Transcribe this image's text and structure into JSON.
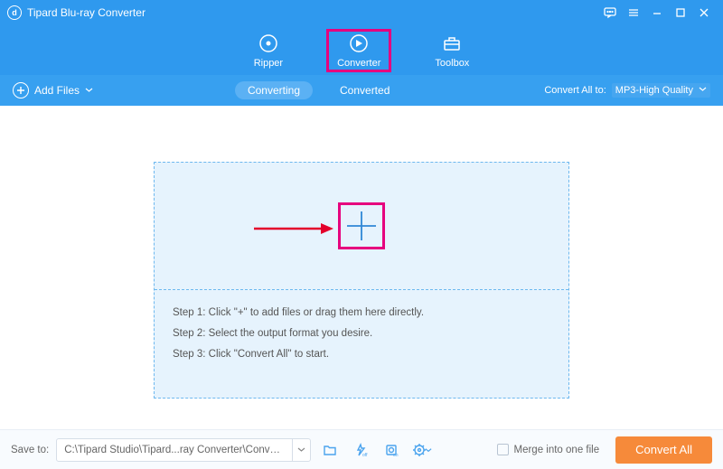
{
  "titlebar": {
    "title": "Tipard Blu-ray Converter"
  },
  "header_tabs": {
    "ripper": "Ripper",
    "converter": "Converter",
    "toolbox": "Toolbox"
  },
  "subbar": {
    "add_files": "Add Files",
    "converting": "Converting",
    "converted": "Converted",
    "convert_all_to_label": "Convert All to:",
    "convert_all_to_value": "MP3-High Quality"
  },
  "steps": {
    "s1": "Step 1: Click \"+\" to add files or drag them here directly.",
    "s2": "Step 2: Select the output format you desire.",
    "s3": "Step 3: Click \"Convert All\" to start."
  },
  "bottom": {
    "save_to_label": "Save to:",
    "save_path": "C:\\Tipard Studio\\Tipard...ray Converter\\Converted",
    "merge_label": "Merge into one file",
    "convert_all": "Convert All"
  }
}
